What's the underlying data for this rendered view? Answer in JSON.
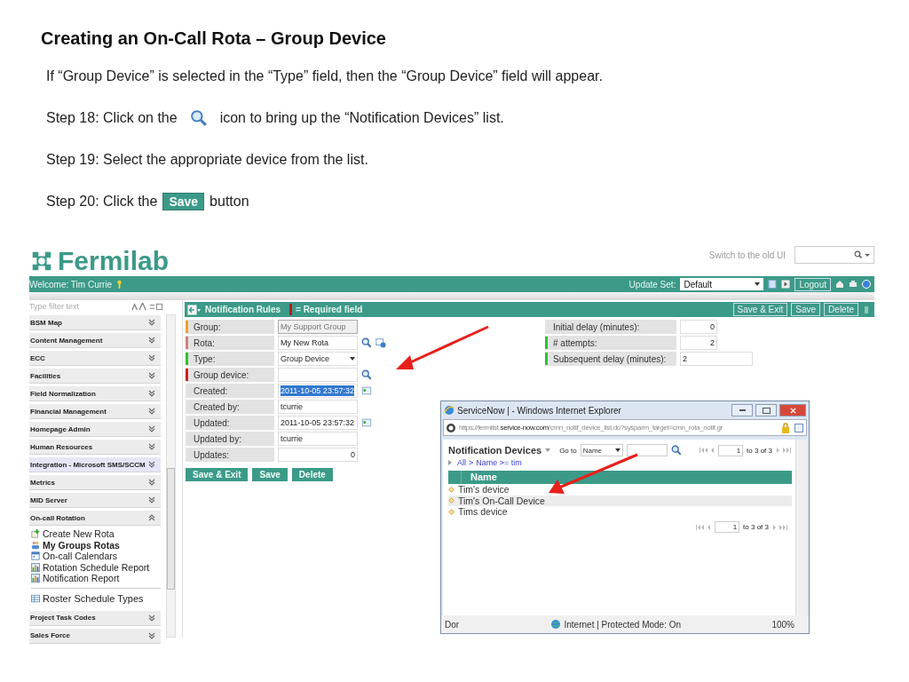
{
  "slide": {
    "title": "Creating an On-Call Rota – Group Device",
    "steps": [
      {
        "parts": [
          {
            "kind": "text",
            "text": "If “Group Device” is selected in the “Type” field, then the “Group Device” field will appear."
          }
        ]
      },
      {
        "parts": [
          {
            "kind": "text",
            "text": "Step 18: Click on the"
          },
          {
            "kind": "search_icon"
          },
          {
            "kind": "text",
            "text": "icon to bring up the “Notification Devices” list."
          }
        ]
      },
      {
        "parts": [
          {
            "kind": "text",
            "text": "Step 19: Select the appropriate device from the list."
          }
        ]
      },
      {
        "parts": [
          {
            "kind": "text",
            "text": "Step 20: Click the"
          },
          {
            "kind": "button",
            "text": "Save"
          },
          {
            "kind": "text",
            "text": "button"
          }
        ]
      }
    ]
  },
  "app": {
    "logo": "Fermilab",
    "switch_link": "Switch to the old UI",
    "welcome": "Welcome: Tim Currie",
    "update_set_label": "Update Set:",
    "update_set_value": "Default",
    "logout": "Logout"
  },
  "sidebar": {
    "filter_placeholder": "Type filter text",
    "items": [
      {
        "label": "BSM Map",
        "expanded": false,
        "highlighted": false
      },
      {
        "label": "Content Management",
        "expanded": false,
        "highlighted": false
      },
      {
        "label": "ECC",
        "expanded": false,
        "highlighted": false
      },
      {
        "label": "Facilities",
        "expanded": false,
        "highlighted": false
      },
      {
        "label": "Field Normalization",
        "expanded": false,
        "highlighted": false
      },
      {
        "label": "Financial Management",
        "expanded": false,
        "highlighted": false
      },
      {
        "label": "Homepage Admin",
        "expanded": false,
        "highlighted": false
      },
      {
        "label": "Human Resources",
        "expanded": false,
        "highlighted": false
      },
      {
        "label": "Integration - Microsoft SMS/SCCM",
        "expanded": false,
        "highlighted": true
      },
      {
        "label": "Metrics",
        "expanded": false,
        "highlighted": false
      },
      {
        "label": "MID Server",
        "expanded": false,
        "highlighted": false
      },
      {
        "label": "On-call Rotation",
        "expanded": true,
        "highlighted": false,
        "children": [
          {
            "label": "Create New Rota",
            "kind": "add",
            "selected": false,
            "divider_above": false
          },
          {
            "label": "My Groups Rotas",
            "kind": "rotas",
            "selected": true,
            "divider_above": false
          },
          {
            "label": "On-call Calendars",
            "kind": "calendar",
            "selected": false,
            "divider_above": false
          },
          {
            "label": "Rotation Schedule Report",
            "kind": "report",
            "selected": false,
            "divider_above": false
          },
          {
            "label": "Notification Report",
            "kind": "report",
            "selected": false,
            "divider_above": false
          },
          {
            "label": "Roster Schedule Types",
            "kind": "types",
            "selected": false,
            "divider_above": true
          }
        ]
      },
      {
        "label": "Project Task Codes",
        "expanded": false,
        "highlighted": false
      },
      {
        "label": "Sales Force",
        "expanded": false,
        "highlighted": false
      }
    ]
  },
  "form": {
    "title": "Notification Rules",
    "required_legend": "= Required field",
    "header_buttons": [
      "Save & Exit",
      "Save",
      "Delete"
    ],
    "left_fields": [
      {
        "label": "Group:",
        "value": "My Support Group",
        "kind": "text",
        "color": "#f0a030",
        "readonly": true,
        "text_selected": false
      },
      {
        "label": "Rota:",
        "value": "My New Rota",
        "kind": "reference",
        "color": "#d08080",
        "readonly": false,
        "text_selected": false
      },
      {
        "label": "Type:",
        "value": "Group Device",
        "kind": "select",
        "color": "#30c030",
        "readonly": false,
        "text_selected": false
      },
      {
        "label": "Group device:",
        "kind": "lookup",
        "color": "#cc2020",
        "readonly": false
      },
      {
        "label": "Created:",
        "value": "2011-10-05 23:57:32",
        "kind": "date",
        "readonly": false,
        "text_selected": true
      },
      {
        "label": "Created by:",
        "value": "tcurrie",
        "kind": "text",
        "readonly": false,
        "text_selected": false
      },
      {
        "label": "Updated:",
        "value": "2011-10-05 23:57:32",
        "kind": "date",
        "readonly": false,
        "text_selected": false
      },
      {
        "label": "Updated by:",
        "value": "tcurrie",
        "kind": "text",
        "readonly": false,
        "text_selected": false
      },
      {
        "label": "Updates:",
        "value": "0",
        "kind": "number",
        "readonly": false,
        "text_selected": false
      }
    ],
    "right_fields": [
      {
        "label": "Initial delay (minutes):",
        "value": "0",
        "kind": "number",
        "readonly": false,
        "text_selected": false
      },
      {
        "label": "# attempts:",
        "value": "2",
        "kind": "number",
        "color": "#30c030",
        "readonly": false,
        "text_selected": false
      },
      {
        "label": "Subsequent delay (minutes):",
        "value": "2",
        "kind": "text",
        "color": "#30c030",
        "readonly": false,
        "text_selected": false
      }
    ],
    "buttons": [
      "Save & Exit",
      "Save",
      "Delete"
    ]
  },
  "popup": {
    "title": "ServiceNow | - Windows Internet Explorer",
    "url": "https://fermitst.**service-now.com**/cmn_notif_device_list.do?sysparm_target=cmn_rota_notif.gr",
    "list_title": "Notification Devices",
    "goto_label": "Go to",
    "goto_field": "Name",
    "page": "1",
    "page_range": "to 3 of 3",
    "breadcrumb": [
      "All",
      "Name >= tim"
    ],
    "breadcrumb_separator": ">",
    "column": "Name",
    "rows": [
      {
        "name": "Tim's device",
        "highlighted": false
      },
      {
        "name": "Tim's On-Call Device",
        "highlighted": true
      },
      {
        "name": "Tims device",
        "highlighted": false
      }
    ],
    "bottom_page": "1",
    "bottom_range": "to 3 of 3",
    "status": "Dor",
    "zone": "Internet | Protected Mode: On",
    "zoom": "100%"
  }
}
